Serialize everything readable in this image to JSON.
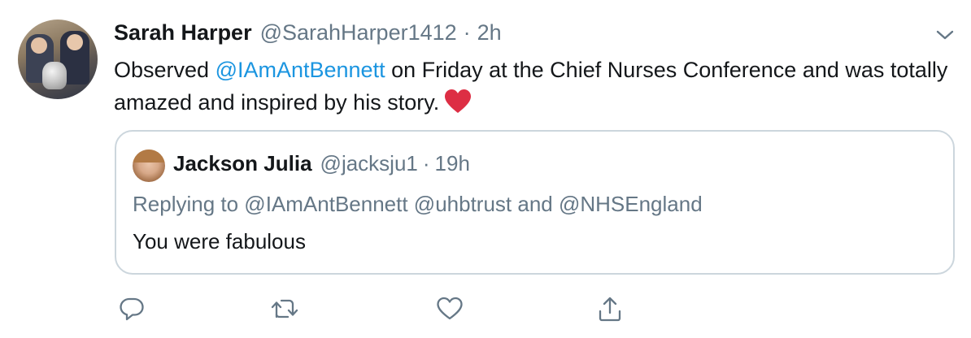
{
  "tweet": {
    "author_name": "Sarah Harper",
    "author_handle": "@SarahHarper1412",
    "separator": "·",
    "time": "2h",
    "text_before": "Observed ",
    "mention": "@IAmAntBennett",
    "text_after": " on Friday at the Chief Nurses Conference and was totally amazed and inspired by his story.",
    "emoji": "red-heart",
    "colors": {
      "text": "#14171a",
      "secondary": "#657786",
      "link": "#1b95e0",
      "border": "#ccd6dd",
      "heart": "#e0245e"
    }
  },
  "quoted_tweet": {
    "author_name": "Jackson Julia",
    "author_handle": "@jacksju1",
    "separator": "·",
    "time": "19h",
    "replying_to": "Replying to @IAmAntBennett @uhbtrust and @NHSEngland",
    "text": "You were fabulous"
  },
  "actions": [
    {
      "name": "reply",
      "icon": "reply-icon"
    },
    {
      "name": "retweet",
      "icon": "retweet-icon"
    },
    {
      "name": "like",
      "icon": "heart-icon"
    },
    {
      "name": "share",
      "icon": "share-icon"
    }
  ],
  "menu": {
    "icon": "chevron-down-icon"
  }
}
